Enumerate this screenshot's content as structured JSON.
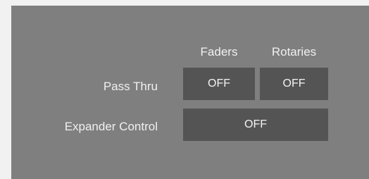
{
  "columns": {
    "faders": "Faders",
    "rotaries": "Rotaries"
  },
  "rows": {
    "pass_thru": {
      "label": "Pass Thru",
      "faders_value": "OFF",
      "rotaries_value": "OFF"
    },
    "expander_control": {
      "label": "Expander Control",
      "value": "OFF"
    }
  },
  "colors": {
    "page_background": "#f1f1f2",
    "panel_background": "#807f80",
    "button_background": "#555455",
    "text": "#f0f0f0"
  }
}
